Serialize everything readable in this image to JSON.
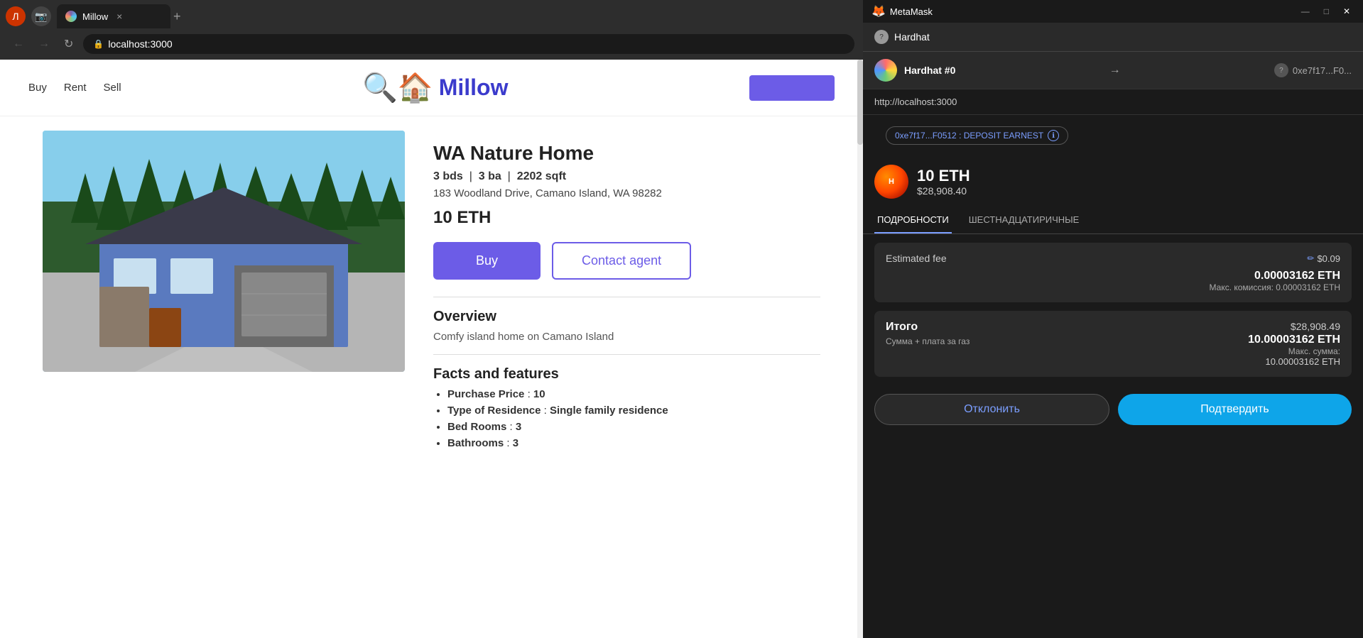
{
  "browser": {
    "url": "localhost:3000",
    "tab_title": "Millow",
    "back_label": "←",
    "forward_label": "→",
    "refresh_label": "↻",
    "new_tab_label": "+"
  },
  "nav": {
    "buy": "Buy",
    "rent": "Rent",
    "sell": "Sell",
    "logo_text": "Millow"
  },
  "property": {
    "title": "WA Nature Home",
    "beds": "3",
    "baths": "3",
    "sqft": "2202",
    "address": "183 Woodland Drive, Camano Island, WA 98282",
    "price": "10 ETH",
    "beds_label": "bds",
    "baths_label": "ba",
    "sqft_label": "sqft"
  },
  "buttons": {
    "buy": "Buy",
    "contact_agent": "Contact agent"
  },
  "overview": {
    "title": "Overview",
    "description": "Comfy island home on Camano Island"
  },
  "facts": {
    "title": "Facts and features",
    "items": [
      {
        "label": "Purchase Price",
        "value": "10"
      },
      {
        "label": "Type of Residence",
        "value": "Single family residence"
      },
      {
        "label": "Bed Rooms",
        "value": "3"
      },
      {
        "label": "Bathrooms",
        "value": "3"
      }
    ]
  },
  "metamask": {
    "title": "MetaMask",
    "network": "Hardhat",
    "account_name": "Hardhat #0",
    "account_address": "0xe7f17...F0...",
    "url": "http://localhost:3000",
    "contract_tag": "0xe7f17...F0512 : DEPOSIT EARNEST",
    "balance_eth": "10 ETH",
    "balance_usd": "$28,908.40",
    "tab_details": "ПОДРОБНОСТИ",
    "tab_hex": "ШЕСТНАДЦАТИРИЧНЫЕ",
    "estimated_fee_label": "Estimated fee",
    "estimated_fee_usd": "$0.09",
    "estimated_fee_eth": "0.00003162 ETH",
    "max_commission_label": "Макс. комиссия:",
    "max_commission_val": "0.00003162 ETH",
    "total_label": "Итого",
    "total_usd": "$28,908.49",
    "total_eth": "10.00003162 ETH",
    "total_sub_label": "Сумма + плата за газ",
    "max_sum_label": "Макс. сумма:",
    "max_sum_val": "10.00003162 ETH",
    "reject_btn": "Отклонить",
    "confirm_btn": "Подтвердить",
    "edit_icon": "✏"
  }
}
